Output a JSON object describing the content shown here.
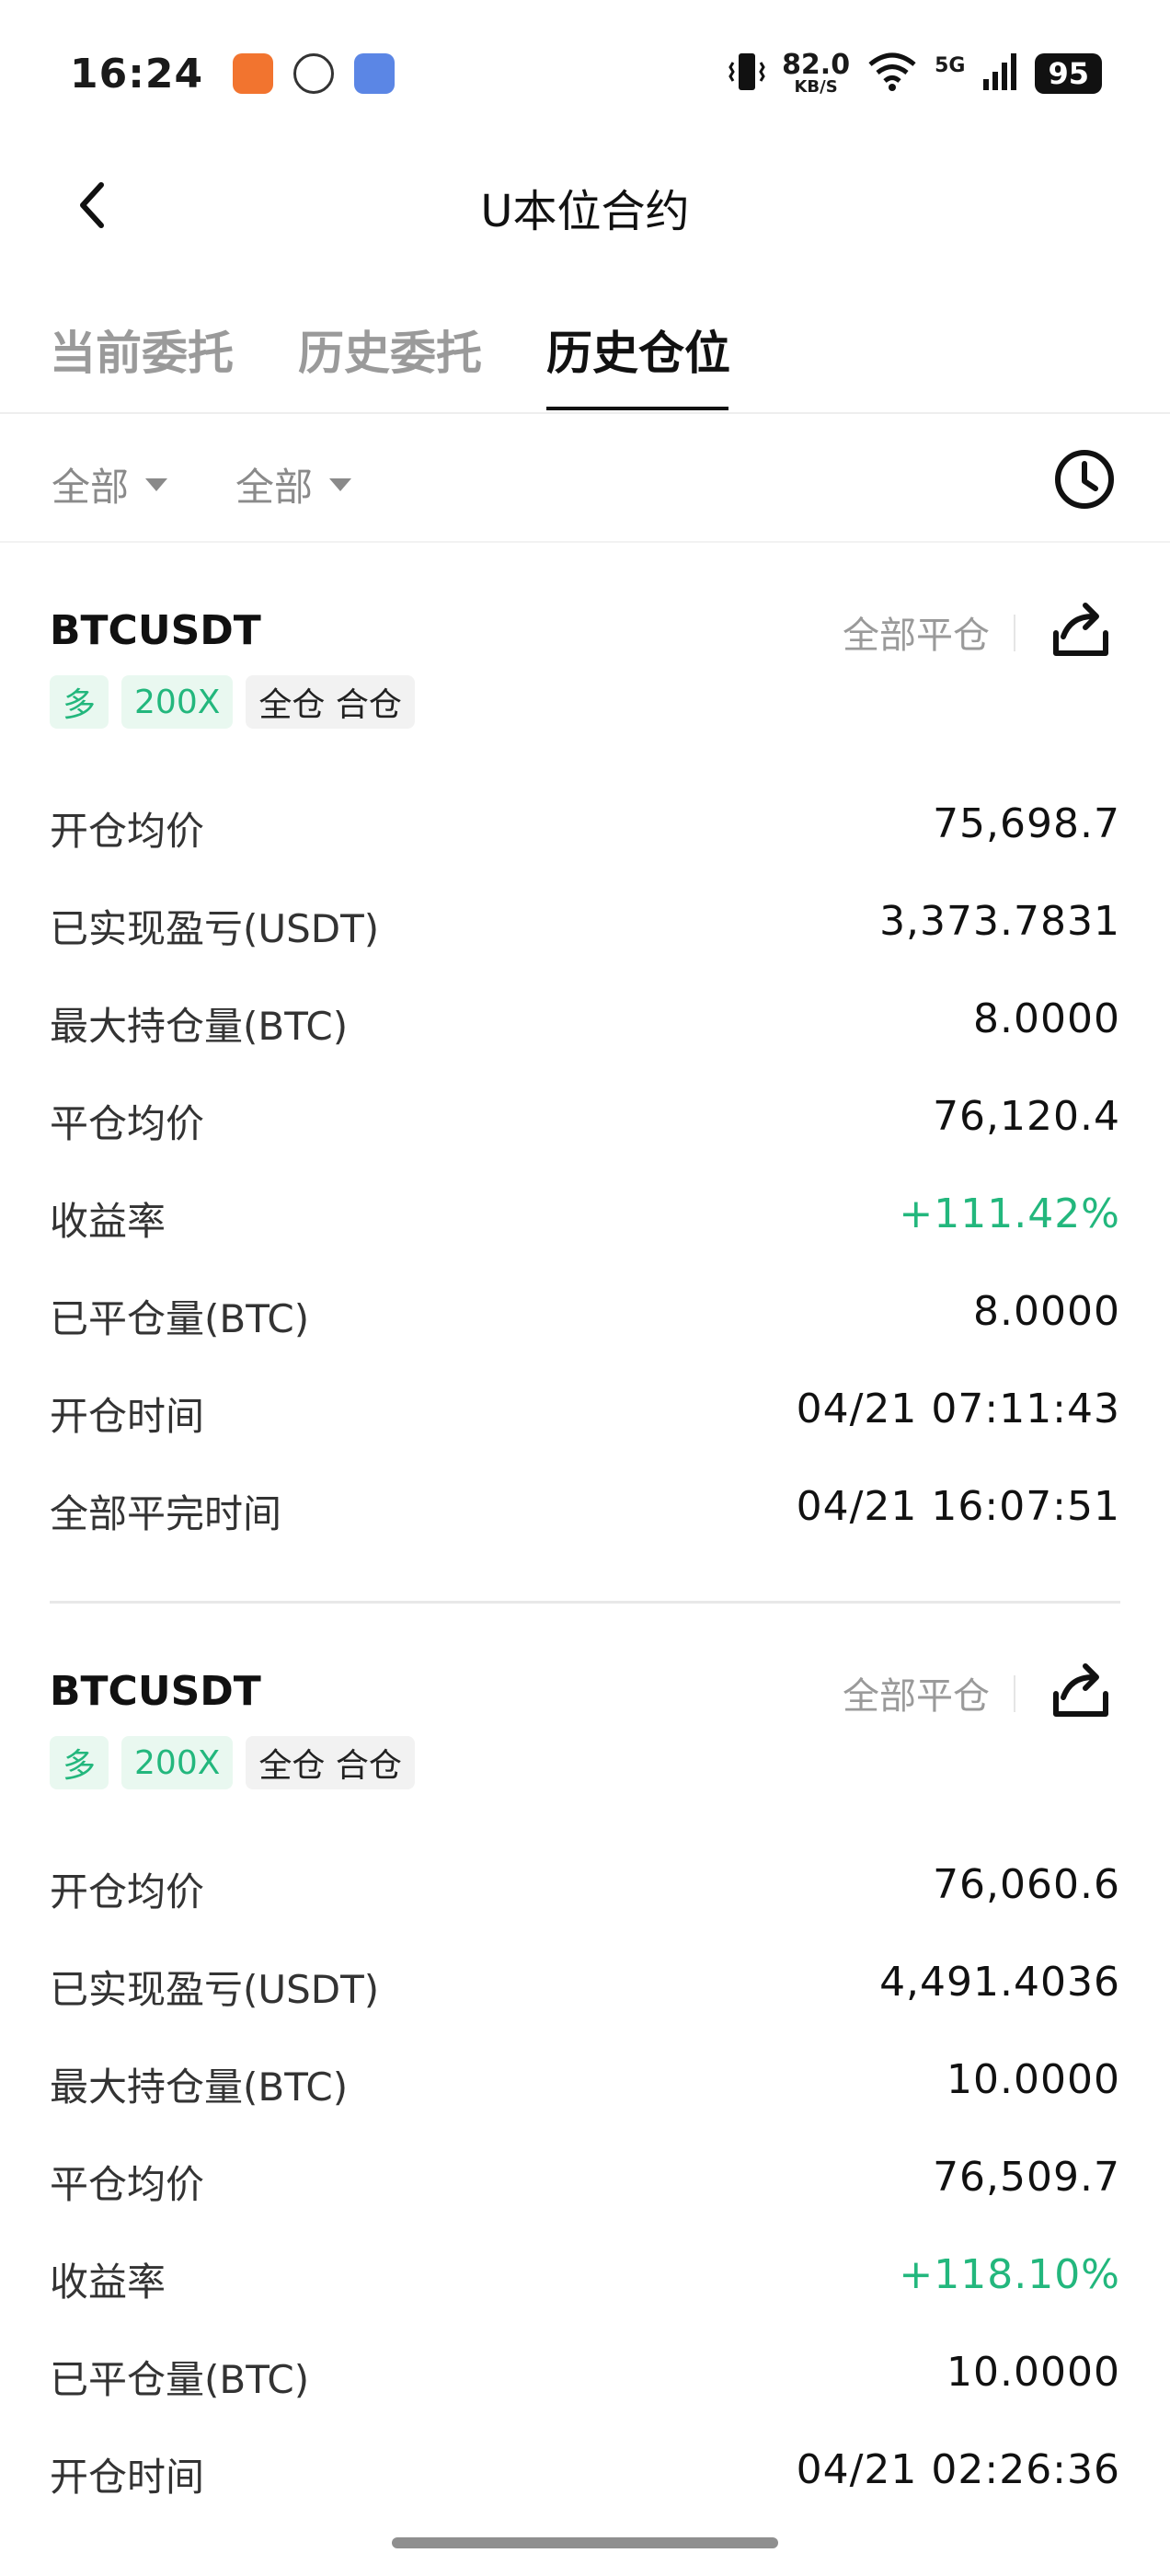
{
  "status_bar": {
    "time": "16:24",
    "speed_value": "82.0",
    "speed_unit": "KB/S",
    "network_label": "5G",
    "battery": "95",
    "icons": [
      "app-icon",
      "app-icon",
      "app-icon",
      "vibrate-icon",
      "wifi-icon",
      "signal-icon"
    ]
  },
  "header": {
    "title": "U本位合约",
    "back_icon": "chevron-left-icon"
  },
  "tabs": [
    {
      "label": "当前委托",
      "active": false
    },
    {
      "label": "历史委托",
      "active": false
    },
    {
      "label": "历史仓位",
      "active": true
    }
  ],
  "filters": [
    {
      "label": "全部"
    },
    {
      "label": "全部"
    }
  ],
  "history_icon": "clock-icon",
  "positions": [
    {
      "symbol": "BTCUSDT",
      "close_all_label": "全部平仓",
      "tags": [
        "多",
        "200X",
        "全仓 合仓"
      ],
      "rows": [
        {
          "label": "开仓均价",
          "value": "75,698.7"
        },
        {
          "label": "已实现盈亏(USDT)",
          "value": "3,373.7831"
        },
        {
          "label": "最大持仓量(BTC)",
          "value": "8.0000"
        },
        {
          "label": "平仓均价",
          "value": "76,120.4"
        },
        {
          "label": "收益率",
          "value": "+111.42%",
          "highlight": "#23b77d"
        },
        {
          "label": "已平仓量(BTC)",
          "value": "8.0000"
        },
        {
          "label": "开仓时间",
          "value": "04/21 07:11:43"
        },
        {
          "label": "全部平完时间",
          "value": "04/21 16:07:51"
        }
      ]
    },
    {
      "symbol": "BTCUSDT",
      "close_all_label": "全部平仓",
      "tags": [
        "多",
        "200X",
        "全仓 合仓"
      ],
      "rows": [
        {
          "label": "开仓均价",
          "value": "76,060.6"
        },
        {
          "label": "已实现盈亏(USDT)",
          "value": "4,491.4036"
        },
        {
          "label": "最大持仓量(BTC)",
          "value": "10.0000"
        },
        {
          "label": "平仓均价",
          "value": "76,509.7"
        },
        {
          "label": "收益率",
          "value": "+118.10%",
          "highlight": "#23b77d"
        },
        {
          "label": "已平仓量(BTC)",
          "value": "10.0000"
        },
        {
          "label": "开仓时间",
          "value": "04/21 02:26:36"
        }
      ]
    }
  ]
}
